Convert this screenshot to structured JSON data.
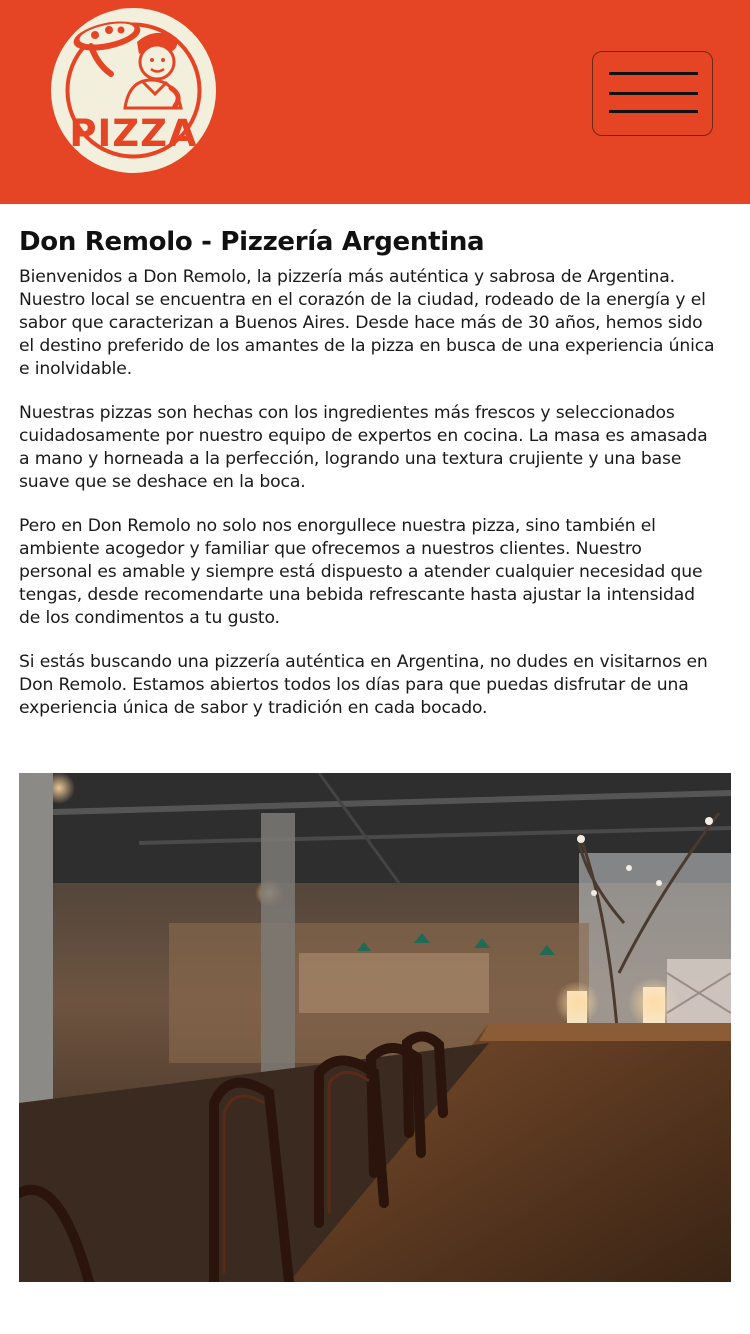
{
  "header": {
    "logo_text": "PIZZA",
    "menu_icon": "hamburger-menu-icon",
    "background_color": "#e64525"
  },
  "main": {
    "title": "Don Remolo - Pizzería Argentina",
    "paragraphs": [
      "Bienvenidos a Don Remolo, la pizzería más auténtica y sabrosa de Argentina. Nuestro local se encuentra en el corazón de la ciudad, rodeado de la energía y el sabor que caracterizan a Buenos Aires. Desde hace más de 30 años, hemos sido el destino preferido de los amantes de la pizza en busca de una experiencia única e inolvidable.",
      "Nuestras pizzas son hechas con los ingredientes más frescos y seleccionados cuidadosamente por nuestro equipo de expertos en cocina. La masa es amasada a mano y horneada a la perfección, logrando una textura crujiente y una base suave que se deshace en la boca.",
      "Pero en Don Remolo no solo nos enorgullece nuestra pizza, sino también el ambiente acogedor y familiar que ofrecemos a nuestros clientes. Nuestro personal es amable y siempre está dispuesto a atender cualquier necesidad que tengas, desde recomendarte una bebida refrescante hasta ajustar la intensidad de los condimentos a tu gusto.",
      "Si estás buscando una pizzería auténtica en Argentina, no dudes en visitarnos en Don Remolo. Estamos abiertos todos los días para que puedas disfrutar de una experiencia única de sabor y tradición en cada bocado."
    ]
  }
}
